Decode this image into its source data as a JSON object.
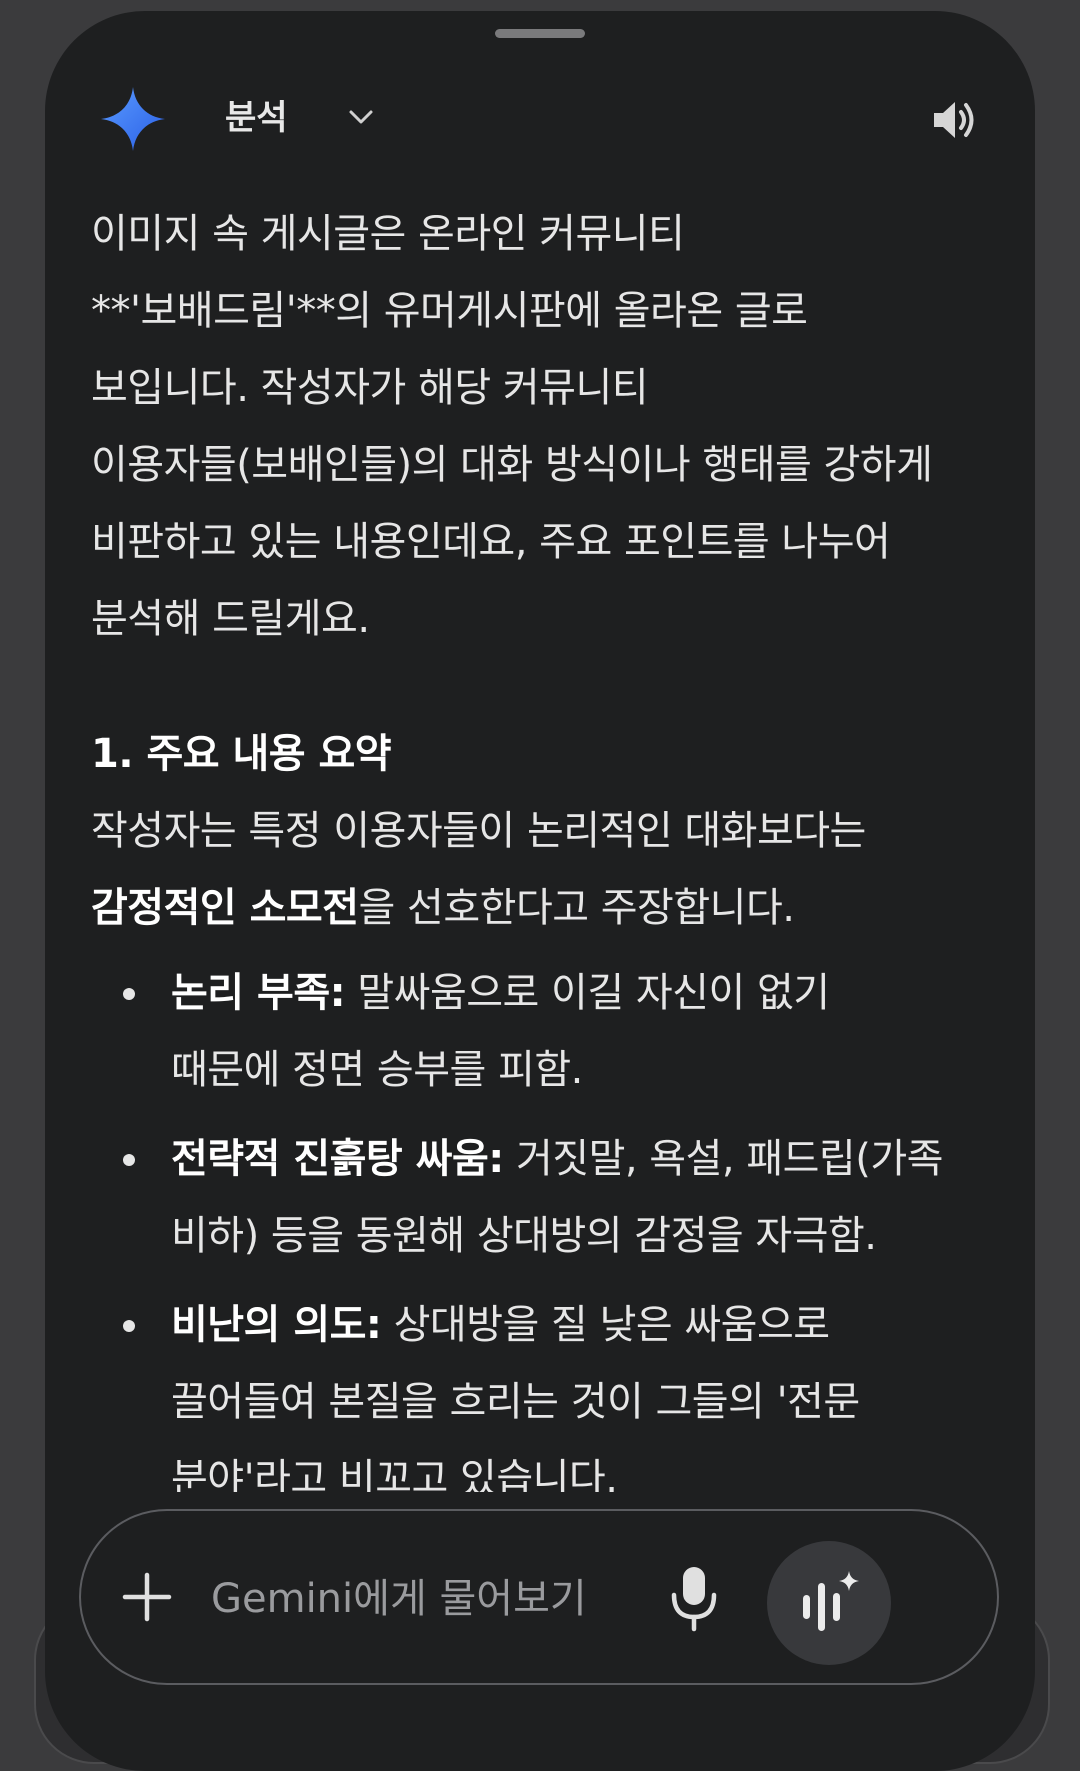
{
  "header": {
    "mode_label": "분석",
    "icons": {
      "logo": "gemini-star-icon",
      "mode_dropdown": "chevron-down-icon",
      "read_aloud": "speaker-icon"
    }
  },
  "response": {
    "intro_lines": [
      "이미지 속 게시글은 온라인 커뮤니티",
      "**'보배드림'**의 유머게시판에 올라온 글로",
      "보입니다. 작성자가 해당 커뮤니티",
      "이용자들(보배인들)의 대화 방식이나 행태를 강하게",
      "비판하고 있는 내용인데요, 주요 포인트를 나누어",
      "분석해 드릴게요."
    ],
    "section_title": "1. 주요 내용 요약",
    "summary": {
      "line1": "작성자는 특정 이용자들이 논리적인 대화보다는",
      "line2_strong": "감정적인 소모전",
      "line2_rest": "을 선호한다고 주장합니다."
    },
    "bullets": [
      {
        "title": "논리 부족:",
        "line1": " 말싸움으로 이길 자신이 없기",
        "line2": "때문에 정면 승부를 피함."
      },
      {
        "title": "전략적 진흙탕 싸움:",
        "line1": " 거짓말, 욕설, 패드립(가족",
        "line2": "비하) 등을 동원해 상대방의 감정을 자극함."
      },
      {
        "title": "비난의 의도:",
        "line1": " 상대방을 질 낮은 싸움으로",
        "line2": "끌어들여 본질을 흐리는 것이 그들의 '전문",
        "line3": "분야'라고 비꼬고 있습니다."
      }
    ]
  },
  "input_bar": {
    "placeholder": "Gemini에게 물어보기",
    "icons": {
      "add": "plus-icon",
      "voice": "microphone-icon",
      "live": "live-waveform-icon"
    }
  },
  "colors": {
    "background": "#1e1f20",
    "text": "#e6e6e6",
    "star_gradient_start": "#4f8cff",
    "star_gradient_end": "#2c5fe0"
  }
}
